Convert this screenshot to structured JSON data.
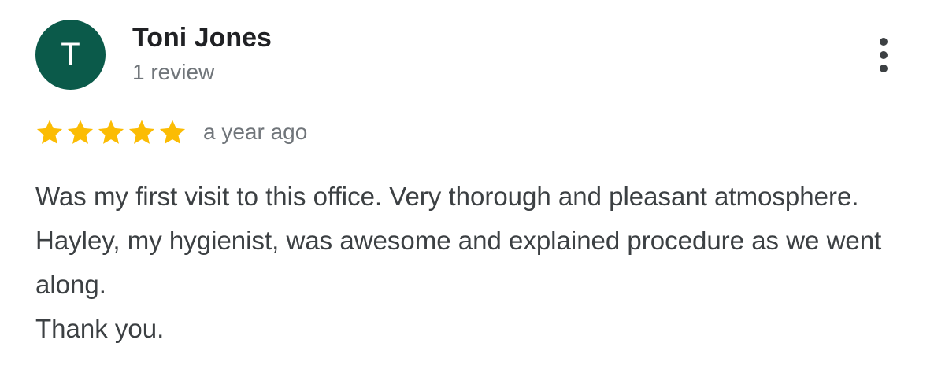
{
  "reviewer": {
    "initial": "T",
    "name": "Toni Jones",
    "review_count": "1 review",
    "avatar_color": "#0b5a4a"
  },
  "menu": {
    "icon": "more-vert-icon"
  },
  "rating": {
    "stars": 5,
    "max_stars": 5,
    "star_color": "#fbbc04",
    "date": "a year ago"
  },
  "review": {
    "text": "Was my first visit to this office. Very thorough and pleasant atmosphere. Hayley, my hygienist, was awesome and explained procedure as we went along.",
    "closing": "Thank you."
  }
}
